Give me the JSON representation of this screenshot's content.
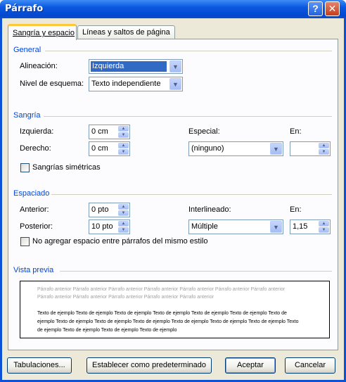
{
  "window": {
    "title": "Párrafo",
    "help_label": "?",
    "close_label": "✕"
  },
  "tabs": [
    {
      "label": "Sangría y espacio",
      "active": true
    },
    {
      "label": "Líneas y saltos de página",
      "active": false
    }
  ],
  "general": {
    "heading": "General",
    "alignment_label": "Alineación:",
    "alignment_value": "Izquierda",
    "outline_label": "Nivel de esquema:",
    "outline_value": "Texto independiente"
  },
  "indent": {
    "heading": "Sangría",
    "left_label": "Izquierda:",
    "left_value": "0 cm",
    "right_label": "Derecho:",
    "right_value": "0 cm",
    "special_label": "Especial:",
    "special_value": "(ninguno)",
    "by_label": "En:",
    "by_value": "",
    "mirror_label": "Sangrías simétricas",
    "mirror_checked": false
  },
  "spacing": {
    "heading": "Espaciado",
    "before_label": "Anterior:",
    "before_value": "0 pto",
    "after_label": "Posterior:",
    "after_value": "10 pto",
    "line_label": "Interlineado:",
    "line_value": "Múltiple",
    "at_label": "En:",
    "at_value": "1,15",
    "no_space_label": "No agregar espacio entre párrafos del mismo estilo",
    "no_space_checked": false
  },
  "preview": {
    "heading": "Vista previa",
    "previous_text": "Párrafo anterior Párrafo anterior Párrafo anterior Párrafo anterior Párrafo anterior Párrafo anterior Párrafo anterior Párrafo anterior Párrafo anterior Párrafo anterior Párrafo anterior Párrafo anterior",
    "sample_text": "Texto de ejemplo Texto de ejemplo Texto de ejemplo Texto de ejemplo Texto de ejemplo Texto de ejemplo Texto de ejemplo Texto de ejemplo Texto de ejemplo Texto de ejemplo Texto de ejemplo Texto de ejemplo Texto de ejemplo Texto de ejemplo Texto de ejemplo Texto de ejemplo Texto de ejemplo"
  },
  "buttons": {
    "tabs": "Tabulaciones...",
    "set_default": "Establecer como predeterminado",
    "ok": "Aceptar",
    "cancel": "Cancelar"
  },
  "colors": {
    "title_bar": "#0a58e0",
    "section_heading": "#0046d5",
    "face": "#ece9d8",
    "selection": "#316ac5"
  }
}
